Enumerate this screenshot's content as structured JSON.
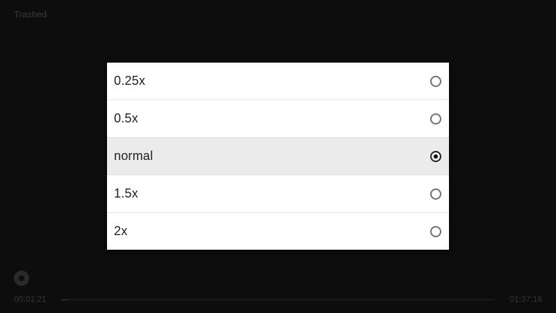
{
  "player": {
    "title": "Trashed",
    "time_current": "00:01:21",
    "time_total": "01:37:16",
    "progress_fraction": 0.014,
    "settings_icon": "gear-icon"
  },
  "speed_dialog": {
    "options": [
      {
        "label": "0.25x",
        "selected": false
      },
      {
        "label": "0.5x",
        "selected": false
      },
      {
        "label": "normal",
        "selected": true
      },
      {
        "label": "1.5x",
        "selected": false
      },
      {
        "label": "2x",
        "selected": false
      }
    ]
  }
}
